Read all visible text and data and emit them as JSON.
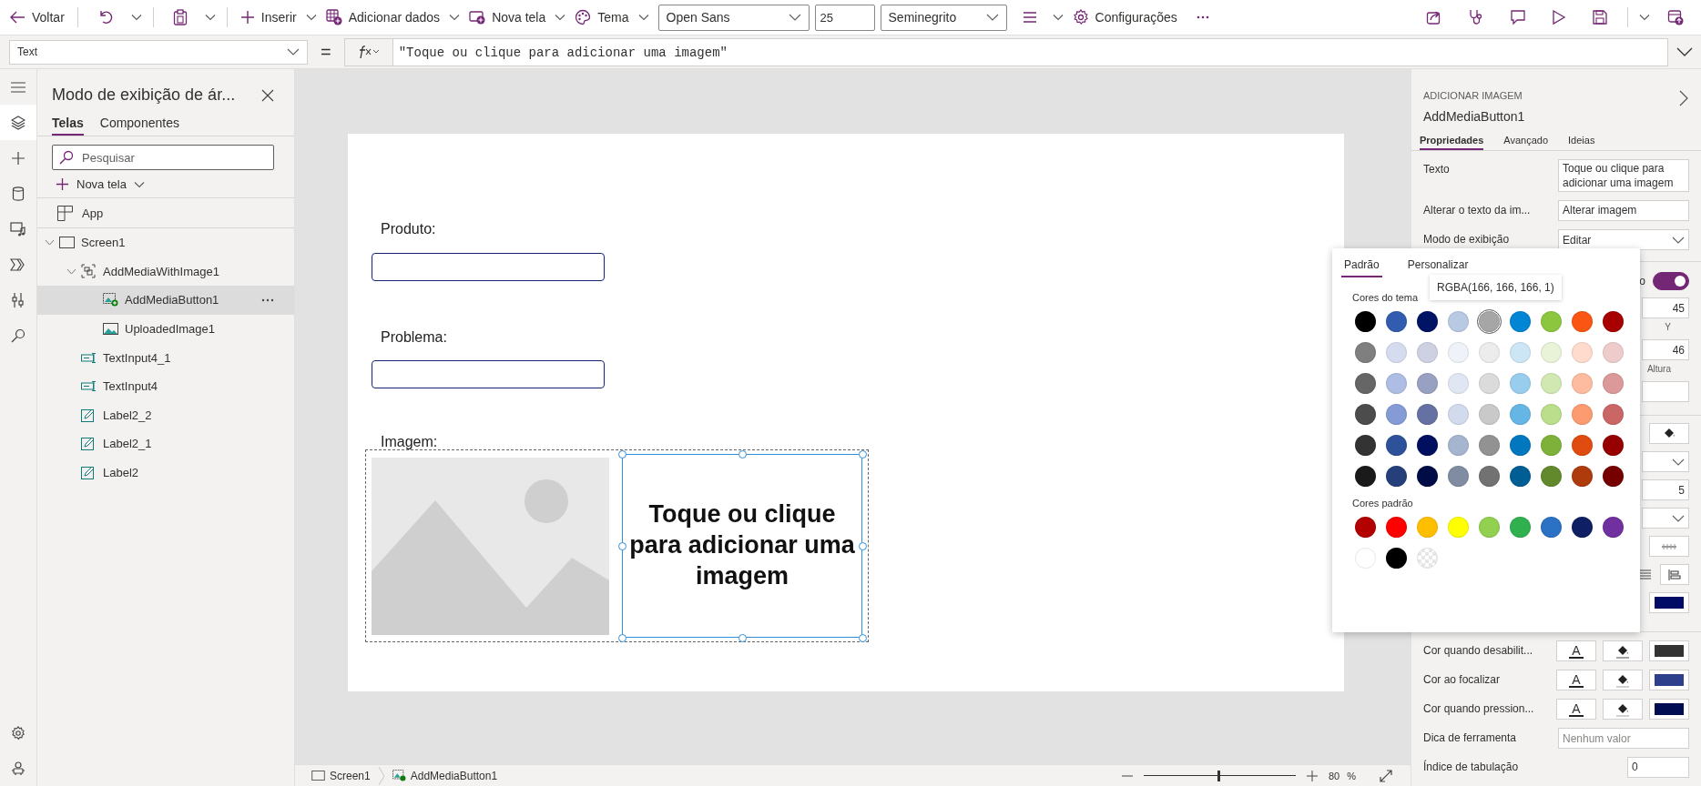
{
  "toolbar": {
    "items": [
      {
        "kind": "back",
        "label": "Voltar"
      },
      {
        "kind": "separator"
      },
      {
        "kind": "undo"
      },
      {
        "kind": "caret"
      },
      {
        "kind": "separator"
      },
      {
        "kind": "clipboard"
      },
      {
        "kind": "caret"
      },
      {
        "kind": "separator"
      },
      {
        "kind": "plus",
        "label": "Inserir",
        "caret": true
      },
      {
        "kind": "data",
        "label": "Adicionar dados",
        "caret": true
      },
      {
        "kind": "screen",
        "label": "Nova tela",
        "caret": true
      },
      {
        "kind": "palette",
        "label": "Tema",
        "caret": true
      },
      {
        "kind": "font-dropdown",
        "value": "Open Sans"
      },
      {
        "kind": "size-field",
        "value": "25"
      },
      {
        "kind": "weight-dropdown",
        "value": "Seminegrito"
      },
      {
        "kind": "align",
        "caret": true
      },
      {
        "kind": "gear",
        "label": "Configurações"
      },
      {
        "kind": "more"
      }
    ],
    "right_items": [
      {
        "kind": "share"
      },
      {
        "kind": "stethoscope"
      },
      {
        "kind": "comment"
      },
      {
        "kind": "play"
      },
      {
        "kind": "save"
      },
      {
        "kind": "separator"
      },
      {
        "kind": "caret"
      },
      {
        "kind": "publish"
      }
    ]
  },
  "formula_bar": {
    "property": "Text",
    "equals": "=",
    "formula": "\"Toque ou clique para adicionar uma imagem\""
  },
  "rail": {
    "top": [
      {
        "kind": "menu",
        "selected": false
      },
      {
        "kind": "layers",
        "selected": true
      },
      {
        "kind": "plus",
        "selected": false
      },
      {
        "kind": "database",
        "selected": false
      },
      {
        "kind": "media",
        "selected": false
      },
      {
        "kind": "flow",
        "selected": false
      },
      {
        "kind": "tools",
        "selected": false
      },
      {
        "kind": "search",
        "selected": false
      }
    ],
    "bottom": [
      {
        "kind": "gear",
        "selected": false
      },
      {
        "kind": "bot",
        "selected": false
      }
    ]
  },
  "tree_panel": {
    "title": "Modo de exibição de ár...",
    "tabs": [
      {
        "label": "Telas",
        "selected": true
      },
      {
        "label": "Componentes",
        "selected": false
      }
    ],
    "search": {
      "placeholder": "Pesquisar"
    },
    "new_screen": "Nova tela",
    "app_item": "App",
    "tree": [
      {
        "label": "Screen1",
        "kind": "screen",
        "expanded": true,
        "selected": false,
        "children": [
          {
            "label": "AddMediaWithImage1",
            "kind": "group",
            "expanded": true,
            "selected": false,
            "children": [
              {
                "label": "AddMediaButton1",
                "kind": "add-media",
                "selected": true
              },
              {
                "label": "UploadedImage1",
                "kind": "image",
                "selected": false
              }
            ]
          },
          {
            "label": "TextInput4_1",
            "kind": "input",
            "selected": false
          },
          {
            "label": "TextInput4",
            "kind": "input",
            "selected": false
          },
          {
            "label": "Label2_2",
            "kind": "label",
            "selected": false
          },
          {
            "label": "Label2_1",
            "kind": "label",
            "selected": false
          },
          {
            "label": "Label2",
            "kind": "label",
            "selected": false
          }
        ]
      }
    ]
  },
  "canvas": {
    "labels": [
      "Produto:",
      "Problema:",
      "Imagem:"
    ],
    "button_text": "Toque ou clique para adicionar uma imagem",
    "selected": true
  },
  "status_bar": {
    "breadcrumb": [
      "Screen1",
      "AddMediaButton1"
    ],
    "zoom": {
      "level": 0.49,
      "value": "80",
      "unit": "%"
    }
  },
  "properties_panel": {
    "type": "ADICIONAR IMAGEM",
    "name": "AddMediaButton1",
    "tabs": [
      {
        "label": "Propriedades",
        "selected": true
      },
      {
        "label": "Avançado",
        "selected": false
      },
      {
        "label": "Ideias",
        "selected": false
      }
    ],
    "rows": [
      {
        "kind": "textarea",
        "label": "Texto",
        "value": "Toque ou clique para adicionar uma imagem"
      },
      {
        "kind": "input",
        "label": "Alterar o texto da im...",
        "value": "Alterar imagem"
      },
      {
        "kind": "dropdown",
        "label": "Modo de exibição",
        "value": "Editar"
      }
    ],
    "covered": [
      {
        "kind": "toggle",
        "label": "o",
        "on": true
      },
      {
        "kind": "field",
        "value": "45",
        "caption": "Y"
      },
      {
        "kind": "field",
        "value": "46",
        "caption": "Altura"
      },
      {
        "kind": "field"
      },
      {
        "kind": "divider"
      },
      {
        "kind": "bucket-button"
      },
      {
        "kind": "dropdown"
      },
      {
        "kind": "field",
        "value": "5"
      },
      {
        "kind": "dropdown"
      },
      {
        "kind": "strike-button"
      },
      {
        "kind": "align-button"
      },
      {
        "kind": "swatch",
        "color": "#000c66"
      }
    ],
    "color_rows": [
      {
        "label": "Cor quando desabilit...",
        "letter": "A",
        "color": "#333333"
      },
      {
        "label": "Cor ao focalizar",
        "letter": "A",
        "color": "#2e3f8c"
      },
      {
        "label": "Cor quando pression...",
        "letter": "A",
        "color": "#000c52"
      }
    ],
    "tooltip_row": {
      "label": "Dica de ferramenta",
      "placeholder": "Nenhum valor"
    },
    "tab_index_row": {
      "label": "Índice de tabulação",
      "value": "0"
    }
  },
  "color_picker": {
    "tabs": [
      {
        "label": "Padrão",
        "selected": true
      },
      {
        "label": "Personalizar",
        "selected": false
      }
    ],
    "tooltip": "RGBA(166, 166, 166, 1)",
    "theme_title": "Cores do tema",
    "theme_colors": [
      [
        {
          "color": "#000000",
          "selected": false
        },
        {
          "color": "#325cb0",
          "selected": false
        },
        {
          "color": "#001466",
          "selected": false
        },
        {
          "color": "#b8c9e4",
          "selected": false
        },
        {
          "color": "#a6a6a6",
          "selected": true
        },
        {
          "color": "#0086d4",
          "selected": false
        },
        {
          "color": "#8cc63f",
          "selected": false
        },
        {
          "color": "#fa5512",
          "selected": false
        },
        {
          "color": "#a80000",
          "selected": false
        }
      ],
      [
        {
          "color": "#7f7f7f",
          "selected": false
        },
        {
          "color": "#d6dcf0",
          "selected": false
        },
        {
          "color": "#cdd1e2",
          "selected": false
        },
        {
          "color": "#eff2f8",
          "selected": false
        },
        {
          "color": "#ececec",
          "selected": false
        },
        {
          "color": "#cce6f6",
          "selected": false
        },
        {
          "color": "#e8f3d8",
          "selected": false
        },
        {
          "color": "#fedbcd",
          "selected": false
        },
        {
          "color": "#eecccc",
          "selected": false
        }
      ],
      [
        {
          "color": "#666666",
          "selected": false
        },
        {
          "color": "#adbde3",
          "selected": false
        },
        {
          "color": "#99a1c2",
          "selected": false
        },
        {
          "color": "#e0e7f3",
          "selected": false
        },
        {
          "color": "#dbdbdb",
          "selected": false
        },
        {
          "color": "#99cdee",
          "selected": false
        },
        {
          "color": "#d1e8b2",
          "selected": false
        },
        {
          "color": "#fdbb9f",
          "selected": false
        },
        {
          "color": "#dc9999",
          "selected": false
        }
      ],
      [
        {
          "color": "#4c4c4c",
          "selected": false
        },
        {
          "color": "#859bd6",
          "selected": false
        },
        {
          "color": "#6671a3",
          "selected": false
        },
        {
          "color": "#d1dbed",
          "selected": false
        },
        {
          "color": "#c9c9c9",
          "selected": false
        },
        {
          "color": "#66b6e5",
          "selected": false
        },
        {
          "color": "#bade8b",
          "selected": false
        },
        {
          "color": "#fc9a70",
          "selected": false
        },
        {
          "color": "#cb6666",
          "selected": false
        }
      ],
      [
        {
          "color": "#333333",
          "selected": false
        },
        {
          "color": "#2e529a",
          "selected": false
        },
        {
          "color": "#00105e",
          "selected": false
        },
        {
          "color": "#a6b5cf",
          "selected": false
        },
        {
          "color": "#929292",
          "selected": false
        },
        {
          "color": "#0077be",
          "selected": false
        },
        {
          "color": "#7eb13a",
          "selected": false
        },
        {
          "color": "#e04c10",
          "selected": false
        },
        {
          "color": "#970000",
          "selected": false
        }
      ],
      [
        {
          "color": "#1a1a1a",
          "selected": false
        },
        {
          "color": "#243f7a",
          "selected": false
        },
        {
          "color": "#000c45",
          "selected": false
        },
        {
          "color": "#7f8ca2",
          "selected": false
        },
        {
          "color": "#727272",
          "selected": false
        },
        {
          "color": "#005e94",
          "selected": false
        },
        {
          "color": "#628a2d",
          "selected": false
        },
        {
          "color": "#ae3b0c",
          "selected": false
        },
        {
          "color": "#760000",
          "selected": false
        }
      ]
    ],
    "standard_title": "Cores padrão",
    "standard_colors": [
      {
        "kind": "color",
        "color": "#b30000",
        "selected": false
      },
      {
        "kind": "color",
        "color": "#ff0000",
        "selected": false
      },
      {
        "kind": "color",
        "color": "#ffbf00",
        "selected": false
      },
      {
        "kind": "color",
        "color": "#ffff00",
        "selected": false
      },
      {
        "kind": "color",
        "color": "#92d050",
        "selected": false
      },
      {
        "kind": "color",
        "color": "#31b050",
        "selected": false
      },
      {
        "kind": "color",
        "color": "#2b72c4",
        "selected": false
      },
      {
        "kind": "color",
        "color": "#0e2063",
        "selected": false
      },
      {
        "kind": "color",
        "color": "#7030a0",
        "selected": false
      },
      {
        "kind": "color",
        "color": "#ffffff",
        "selected": false
      },
      {
        "kind": "color",
        "color": "#000000",
        "selected": false
      },
      {
        "kind": "transparent",
        "selected": false
      }
    ]
  }
}
